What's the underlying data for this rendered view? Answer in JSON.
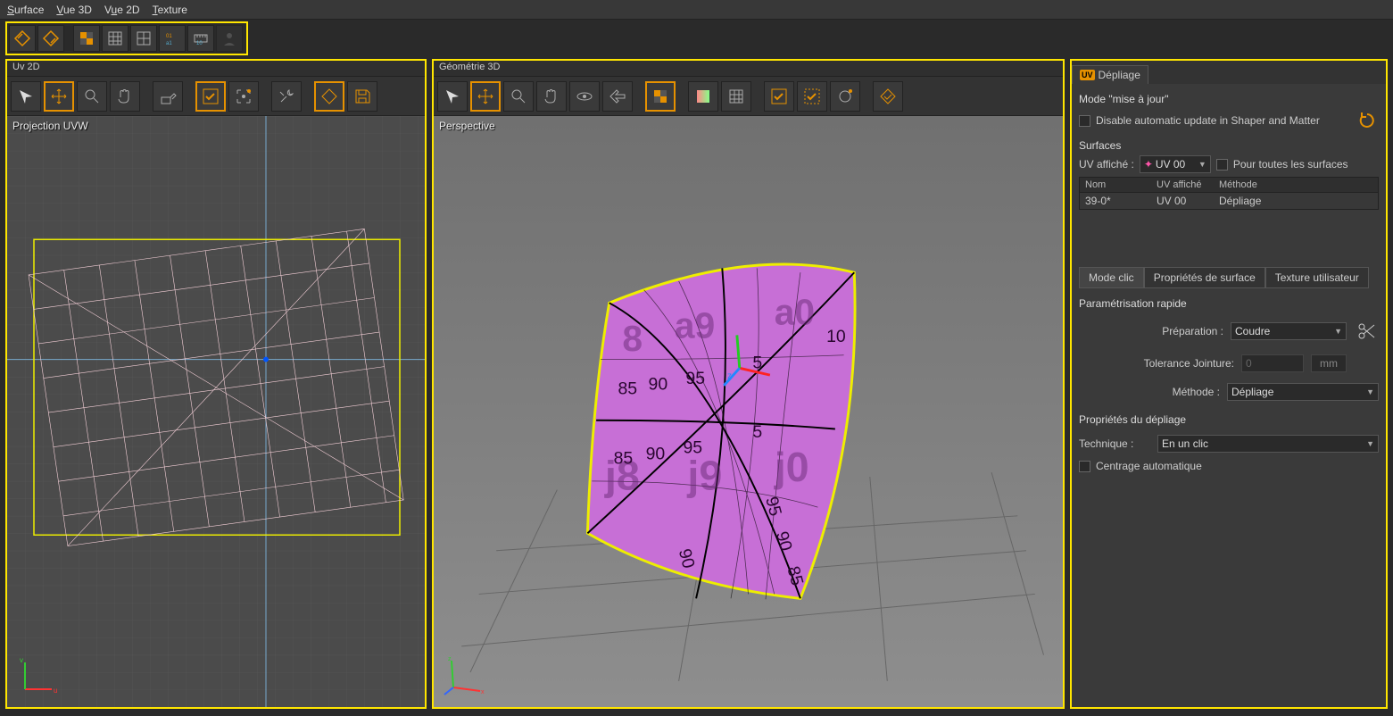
{
  "menu": {
    "surface": "Surface",
    "vue3d": "Vue 3D",
    "vue2d": "Vue 2D",
    "texture": "Texture"
  },
  "panels": {
    "uv": {
      "title": "Uv 2D",
      "viewportLabel": "Projection UVW"
    },
    "geo": {
      "title": "Géométrie 3D",
      "viewportLabel": "Perspective"
    }
  },
  "right": {
    "tabLabel": "Dépliage",
    "modeTitle": "Mode \"mise à jour\"",
    "disableAuto": "Disable automatic update in Shaper and Matter",
    "surfacesHeader": "Surfaces",
    "uvAfficheLabel": "UV affiché :",
    "uvAfficheValue": "UV 00",
    "pourToutes": "Pour toutes les surfaces",
    "cols": {
      "nom": "Nom",
      "uvAffiche": "UV affiché",
      "methode": "Méthode"
    },
    "row": {
      "nom": "39-0*",
      "uv": "UV 00",
      "methode": "Dépliage"
    },
    "tabs2": {
      "modeClic": "Mode clic",
      "proprietes": "Propriétés de surface",
      "textureUtil": "Texture utilisateur"
    },
    "paramRapide": "Paramétrisation rapide",
    "preparationLabel": "Préparation :",
    "preparationValue": "Coudre",
    "toleranceLabel": "Tolerance Jointure:",
    "toleranceValue": "0",
    "toleranceUnit": "mm",
    "methodeLabel": "Méthode :",
    "methodeValue": "Dépliage",
    "propDepliage": "Propriétés du dépliage",
    "techniqueLabel": "Technique :",
    "techniqueValue": "En un clic",
    "centrageAuto": "Centrage automatique"
  }
}
